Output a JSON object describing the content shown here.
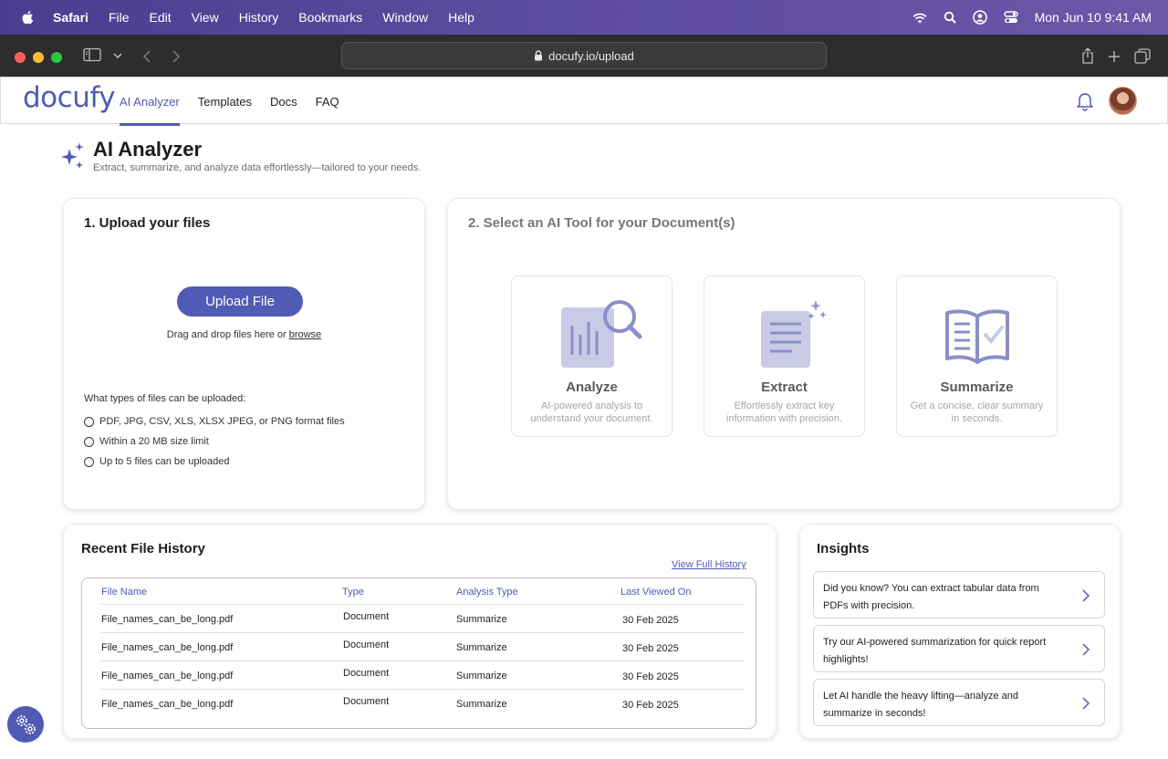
{
  "menubar": {
    "app": "Safari",
    "items": [
      "File",
      "Edit",
      "View",
      "History",
      "Bookmarks",
      "Window",
      "Help"
    ],
    "clock": "Mon Jun 10  9:41 AM",
    "icons": [
      "wifi-icon",
      "spotlight-icon",
      "user-icon",
      "control-center-icon"
    ]
  },
  "browser": {
    "url": "docufy.io/upload"
  },
  "site": {
    "logo": "docufy",
    "nav": [
      "AI Analyzer",
      "Templates",
      "Docs",
      "FAQ"
    ],
    "active_nav": "AI Analyzer",
    "accent_color": "#4f5bb5"
  },
  "page": {
    "title": "AI Analyzer",
    "subtitle": "Extract, summarize, and analyze data effortlessly—tailored to your needs."
  },
  "upload": {
    "title": "1. Upload your files",
    "button": "Upload File",
    "dnd_prefix": "Drag and drop files here or",
    "dnd_link": "browse",
    "types_question": "What types of files can be uploaded:",
    "types": [
      "PDF, JPG, CSV, XLS, XLSX JPEG, or PNG format files",
      "Within a 20 MB size limit",
      "Up to 5 files can be uploaded"
    ]
  },
  "tools": {
    "title": "2. Select an AI Tool for your Document(s)",
    "items": [
      {
        "name": "Analyze",
        "desc": "AI-powered analysis to understand your document."
      },
      {
        "name": "Extract",
        "desc": "Effortlessly extract key information with precision."
      },
      {
        "name": "Summarize",
        "desc": "Get a concise, clear summary in seconds."
      }
    ]
  },
  "history": {
    "title": "Recent File History",
    "view_full": "View Full History",
    "columns": [
      "File Name",
      "Type",
      "Analysis Type",
      "Last Viewed On"
    ],
    "rows": [
      [
        "File_names_can_be_long.pdf",
        "Document",
        "Summarize",
        "30 Feb 2025"
      ],
      [
        "File_names_can_be_long.pdf",
        "Document",
        "Summarize",
        "30 Feb 2025"
      ],
      [
        "File_names_can_be_long.pdf",
        "Document",
        "Summarize",
        "30 Feb 2025"
      ],
      [
        "File_names_can_be_long.pdf",
        "Document",
        "Summarize",
        "30 Feb 2025"
      ]
    ]
  },
  "insights": {
    "title": "Insights",
    "items": [
      "Did you know? You can extract tabular data from PDFs with precision.",
      "Try our AI-powered summarization for quick report highlights!",
      "Let AI handle the heavy lifting—analyze and summarize in seconds!"
    ]
  }
}
